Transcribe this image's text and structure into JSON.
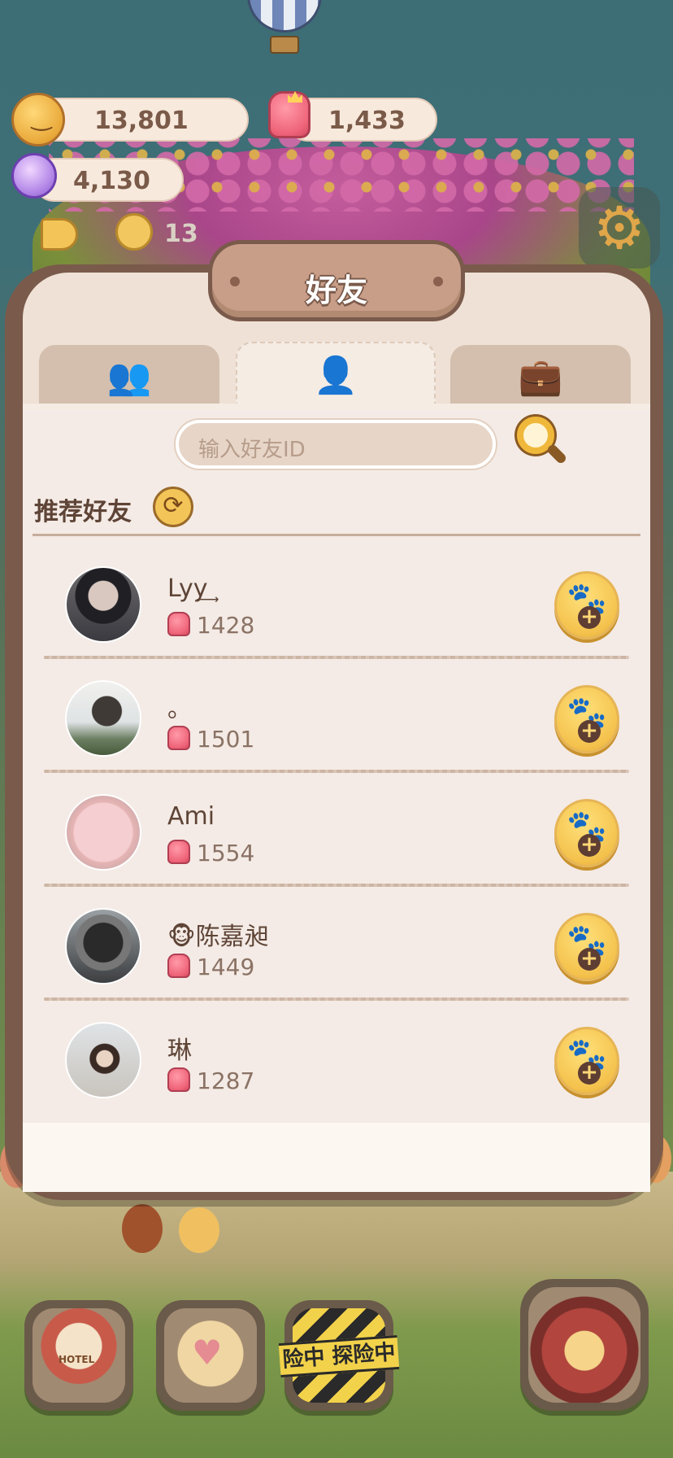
{
  "hud": {
    "coins": "13,801",
    "jelly": "1,433",
    "candy": "4,130",
    "ticket_count": "13"
  },
  "panel": {
    "title": "好友",
    "tabs": [
      {
        "icon": "friends-icon",
        "label": ""
      },
      {
        "icon": "add-friend-icon",
        "label": "",
        "active": true
      },
      {
        "icon": "briefcase-icon",
        "label": ""
      }
    ],
    "search": {
      "placeholder": "输入好友ID",
      "value": ""
    },
    "recommend_title": "推荐好友",
    "friends": [
      {
        "name": "Lyy͢",
        "score": "1428"
      },
      {
        "name": "。",
        "score": "1501"
      },
      {
        "name": "Ami",
        "score": "1554"
      },
      {
        "name": "🐵陈嘉昶",
        "score": "1449"
      },
      {
        "name": "琳",
        "score": "1287"
      }
    ]
  },
  "nav": {
    "hotel_label": "HOTEL",
    "adventure_label": "险中  探险中"
  },
  "colors": {
    "panel_bg": "#efe1d5",
    "frame": "#7a5a4b",
    "text_dark": "#5e4436",
    "text_muted": "#8a7264",
    "gold": "#f4c24d"
  }
}
